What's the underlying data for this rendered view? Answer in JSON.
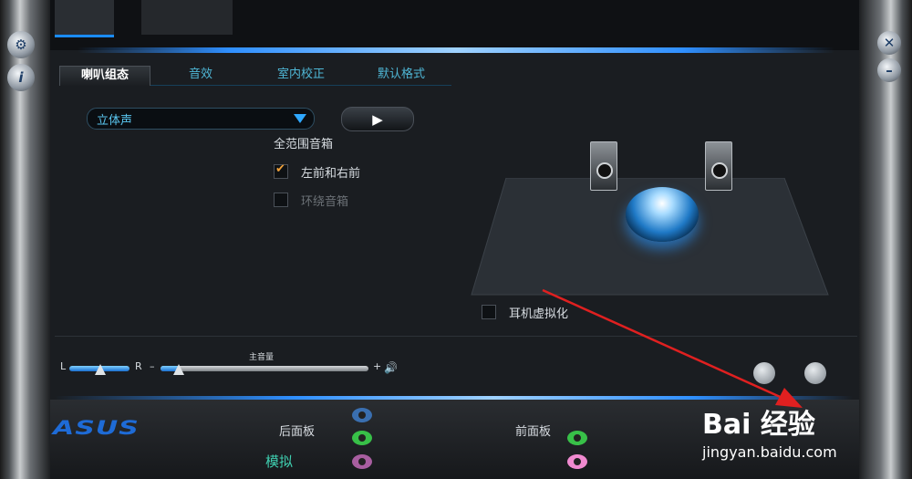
{
  "tabs": [
    {
      "label": "喇叭组态"
    },
    {
      "label": "音效"
    },
    {
      "label": "室内校正"
    },
    {
      "label": "默认格式"
    }
  ],
  "speaker_config": {
    "value": "立体声"
  },
  "section": {
    "title": "全范围音箱"
  },
  "checkboxes": {
    "front": "左前和右前",
    "surround": "环绕音箱"
  },
  "headphone": {
    "label": "耳机虚拟化"
  },
  "volume": {
    "title": "主音量",
    "left": "L",
    "right": "R",
    "minus": "–",
    "plus": "+"
  },
  "brand": {
    "logo": "ASUS"
  },
  "panels": {
    "rear": "后面板",
    "front": "前面板",
    "analog": "模拟"
  },
  "watermark": {
    "top": "Bai  经验",
    "bottom": "jingyan.baidu.com"
  },
  "colors": {
    "accent": "#2f8fff",
    "checkmark": "#f2a23a",
    "arrow": "#e02020"
  }
}
